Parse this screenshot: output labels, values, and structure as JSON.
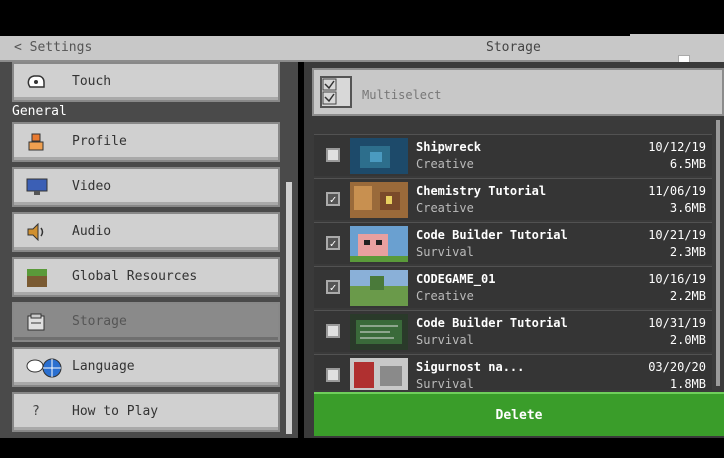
{
  "header": {
    "back_label": "< Settings",
    "title": "Storage"
  },
  "sidebar": {
    "top_item": {
      "label": "Touch",
      "icon": "touch-icon"
    },
    "section": "General",
    "items": [
      {
        "label": "Profile",
        "icon": "profile-icon"
      },
      {
        "label": "Video",
        "icon": "monitor-icon"
      },
      {
        "label": "Audio",
        "icon": "speaker-icon"
      },
      {
        "label": "Global Resources",
        "icon": "grass-block-icon"
      },
      {
        "label": "Storage",
        "icon": "storage-icon",
        "selected": true
      },
      {
        "label": "Language",
        "icon": "globe-icon"
      },
      {
        "label": "How to Play",
        "icon": "question-icon"
      }
    ]
  },
  "multiselect": {
    "label": "Multiselect"
  },
  "worlds": [
    {
      "name": "Shipwreck",
      "mode": "Creative",
      "date": "10/12/19",
      "size": "6.5MB",
      "checked": false
    },
    {
      "name": "Chemistry Tutorial",
      "mode": "Creative",
      "date": "11/06/19",
      "size": "3.6MB",
      "checked": true
    },
    {
      "name": "Code Builder Tutorial",
      "mode": "Survival",
      "date": "10/21/19",
      "size": "2.3MB",
      "checked": true
    },
    {
      "name": "CODEGAME_01",
      "mode": "Creative",
      "date": "10/16/19",
      "size": "2.2MB",
      "checked": true
    },
    {
      "name": "Code Builder Tutorial",
      "mode": "Survival",
      "date": "10/31/19",
      "size": "2.0MB",
      "checked": false
    },
    {
      "name": "Sigurnost na...",
      "mode": "Survival",
      "date": "03/20/20",
      "size": "1.8MB",
      "checked": false
    }
  ],
  "delete_label": "Delete",
  "colors": {
    "delete_green": "#3a9d2a",
    "panel_gray": "#c8c8c8"
  }
}
